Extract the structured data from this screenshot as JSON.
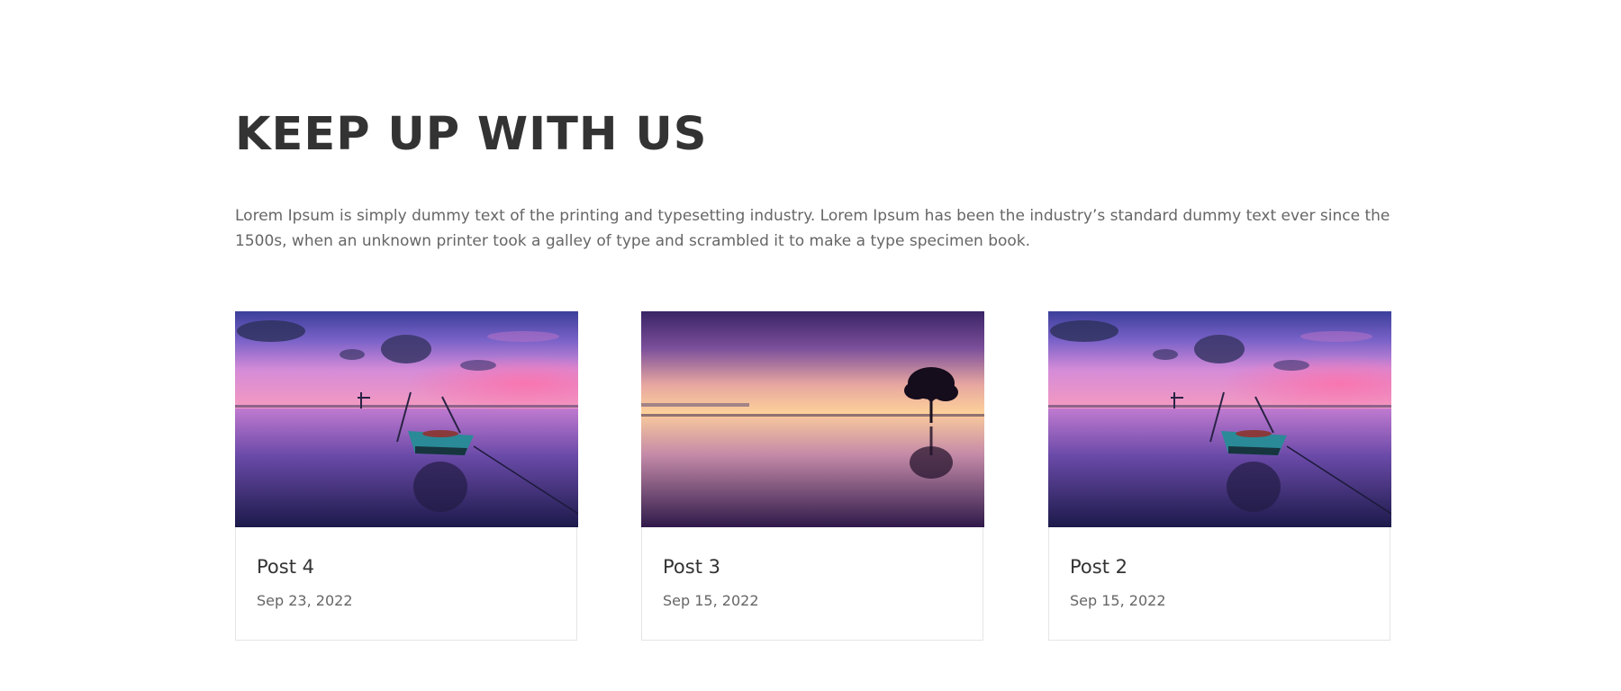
{
  "section": {
    "heading": "KEEP UP WITH US",
    "intro": "Lorem Ipsum is simply dummy text of the printing and typesetting industry. Lorem Ipsum has been the industry’s standard dummy text ever since the 1500s, when an unknown printer took a galley of type and scrambled it to make a type specimen book."
  },
  "posts": [
    {
      "title": "Post 4",
      "date": "Sep 23, 2022",
      "image": "boat-sunset-image"
    },
    {
      "title": "Post 3",
      "date": "Sep 15, 2022",
      "image": "tree-sunset-image"
    },
    {
      "title": "Post 2",
      "date": "Sep 15, 2022",
      "image": "boat-sunset-image"
    }
  ],
  "colors": {
    "heading": "#333333",
    "body_text": "#666666",
    "card_border": "#e5e5e5"
  }
}
